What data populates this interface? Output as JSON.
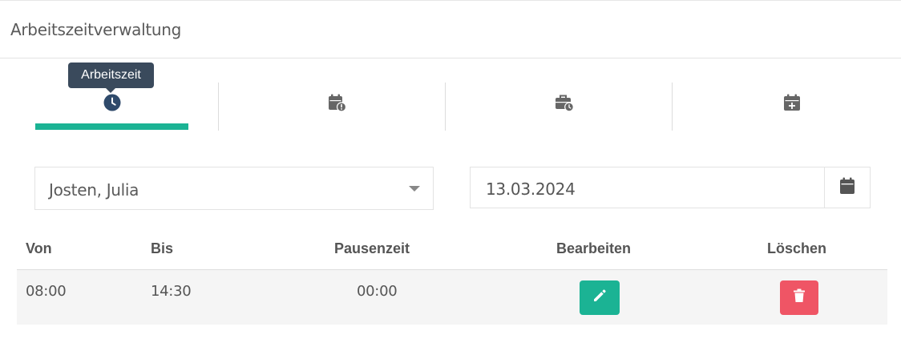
{
  "header": {
    "title": "Arbeitszeitverwaltung"
  },
  "tabs": [
    {
      "name": "Arbeitszeit",
      "icon": "clock-icon",
      "active": true
    },
    {
      "name": "",
      "icon": "calendar-exclamation-icon",
      "active": false
    },
    {
      "name": "",
      "icon": "briefcase-clock-icon",
      "active": false
    },
    {
      "name": "",
      "icon": "calendar-plus-icon",
      "active": false
    }
  ],
  "tooltip": {
    "text": "Arbeitszeit"
  },
  "employee_select": {
    "value": "Josten, Julia"
  },
  "date_field": {
    "value": "13.03.2024"
  },
  "table": {
    "headers": {
      "from": "Von",
      "to": "Bis",
      "break": "Pausenzeit",
      "edit": "Bearbeiten",
      "delete": "Löschen"
    },
    "rows": [
      {
        "from": "08:00",
        "to": "14:30",
        "break": "00:00"
      }
    ]
  },
  "colors": {
    "accent": "#1bb394",
    "danger": "#ef5565",
    "tooltip_bg": "#3a4a5c",
    "icon_active": "#2f4a6b",
    "icon_inactive": "#666666"
  }
}
